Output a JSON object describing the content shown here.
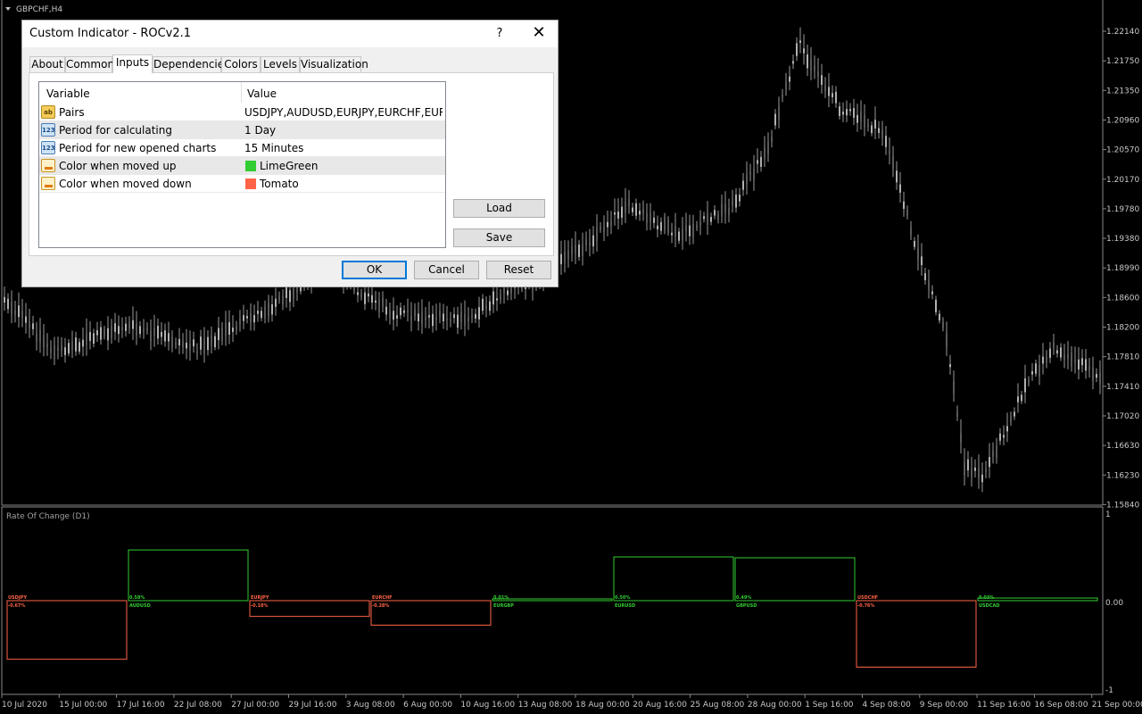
{
  "chart": {
    "symbol": "GBPCHF,H4",
    "price_labels": [
      "1.22140",
      "1.21750",
      "1.21350",
      "1.20960",
      "1.20570",
      "1.20170",
      "1.19780",
      "1.19380",
      "1.18990",
      "1.18600",
      "1.18200",
      "1.17810",
      "1.17410",
      "1.17020",
      "1.16630",
      "1.16230",
      "1.15840"
    ],
    "time_labels": [
      "10 Jul 2020",
      "15 Jul 00:00",
      "17 Jul 16:00",
      "22 Jul 08:00",
      "27 Jul 00:00",
      "29 Jul 16:00",
      "3 Aug 08:00",
      "6 Aug 00:00",
      "10 Aug 16:00",
      "13 Aug 08:00",
      "18 Aug 00:00",
      "20 Aug 16:00",
      "25 Aug 08:00",
      "28 Aug 00:00",
      "1 Sep 16:00",
      "4 Sep 08:00",
      "9 Sep 00:00",
      "11 Sep 16:00",
      "16 Sep 08:00",
      "21 Sep 00:00"
    ],
    "candle_color": "#9a9a9a"
  },
  "indicator": {
    "title": "Rate Of Change (D1)",
    "scale_top": "1",
    "scale_zero": "0.00",
    "scale_bottom": "-1",
    "up_color": "#32cd32",
    "down_color": "#ff6347",
    "pairs": [
      {
        "name": "USDJPY",
        "pct": "-0.67%",
        "value": -0.67
      },
      {
        "name": "AUDUSD",
        "pct": "0.58%",
        "value": 0.58
      },
      {
        "name": "EURJPY",
        "pct": "-0.18%",
        "value": -0.18
      },
      {
        "name": "EURCHF",
        "pct": "-0.28%",
        "value": -0.28
      },
      {
        "name": "EURGBP",
        "pct": "0.01%",
        "value": 0.01
      },
      {
        "name": "EURUSD",
        "pct": "0.50%",
        "value": 0.5
      },
      {
        "name": "GBPUSD",
        "pct": "0.49%",
        "value": 0.49
      },
      {
        "name": "USDCHF",
        "pct": "-0.76%",
        "value": -0.76
      },
      {
        "name": "USDCAD",
        "pct": "0.03%",
        "value": 0.03
      }
    ]
  },
  "dialog": {
    "title": "Custom Indicator - ROCv2.1",
    "help": "?",
    "close": "✕",
    "tabs": [
      "About",
      "Common",
      "Inputs",
      "Dependencies",
      "Colors",
      "Levels",
      "Visualization"
    ],
    "active_tab": "Inputs",
    "grid": {
      "col_variable": "Variable",
      "col_value": "Value",
      "rows": [
        {
          "icon": "ab",
          "variable": "Pairs",
          "value": "USDJPY,AUDUSD,EURJPY,EURCHF,EUR..."
        },
        {
          "icon": "123",
          "variable": "Period for calculating",
          "value": "1 Day"
        },
        {
          "icon": "123",
          "variable": "Period for new opened charts",
          "value": "15 Minutes"
        },
        {
          "icon": "color",
          "variable": "Color when moved up",
          "value": "LimeGreen",
          "swatch": "#32cd32"
        },
        {
          "icon": "color",
          "variable": "Color when moved down",
          "value": "Tomato",
          "swatch": "#ff6347"
        }
      ]
    },
    "load": "Load",
    "save": "Save",
    "ok": "OK",
    "cancel": "Cancel",
    "reset": "Reset"
  }
}
